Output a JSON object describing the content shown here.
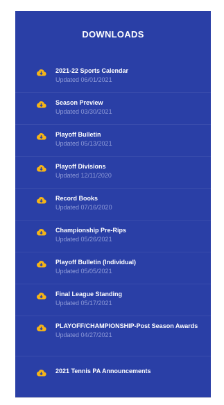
{
  "downloads": {
    "title": "DOWNLOADS",
    "icon": "cloud-download-icon",
    "icon_color": "#f5b417",
    "items": [
      {
        "title": "2021-22 Sports Calendar",
        "updated": "Updated 06/01/2021"
      },
      {
        "title": "Season Preview",
        "updated": "Updated 03/30/2021"
      },
      {
        "title": "Playoff Bulletin",
        "updated": "Updated 05/13/2021"
      },
      {
        "title": "Playoff Divisions",
        "updated": "Updated 12/11/2020"
      },
      {
        "title": "Record Books",
        "updated": "Updated 07/16/2020"
      },
      {
        "title": "Championship Pre-Rips",
        "updated": "Updated 05/26/2021"
      },
      {
        "title": "Playoff Bulletin (Individual)",
        "updated": "Updated 05/05/2021"
      },
      {
        "title": "Final League Standing",
        "updated": "Updated 05/17/2021"
      },
      {
        "title": "PLAYOFF/CHAMPIONSHIP-Post Season Awards",
        "updated": "Updated 04/27/2021"
      },
      {
        "title": "2021 Tennis PA Announcements",
        "updated": ""
      }
    ]
  },
  "colors": {
    "panel_bg": "#2a3fa6",
    "updated_text": "#8f9bd8"
  }
}
